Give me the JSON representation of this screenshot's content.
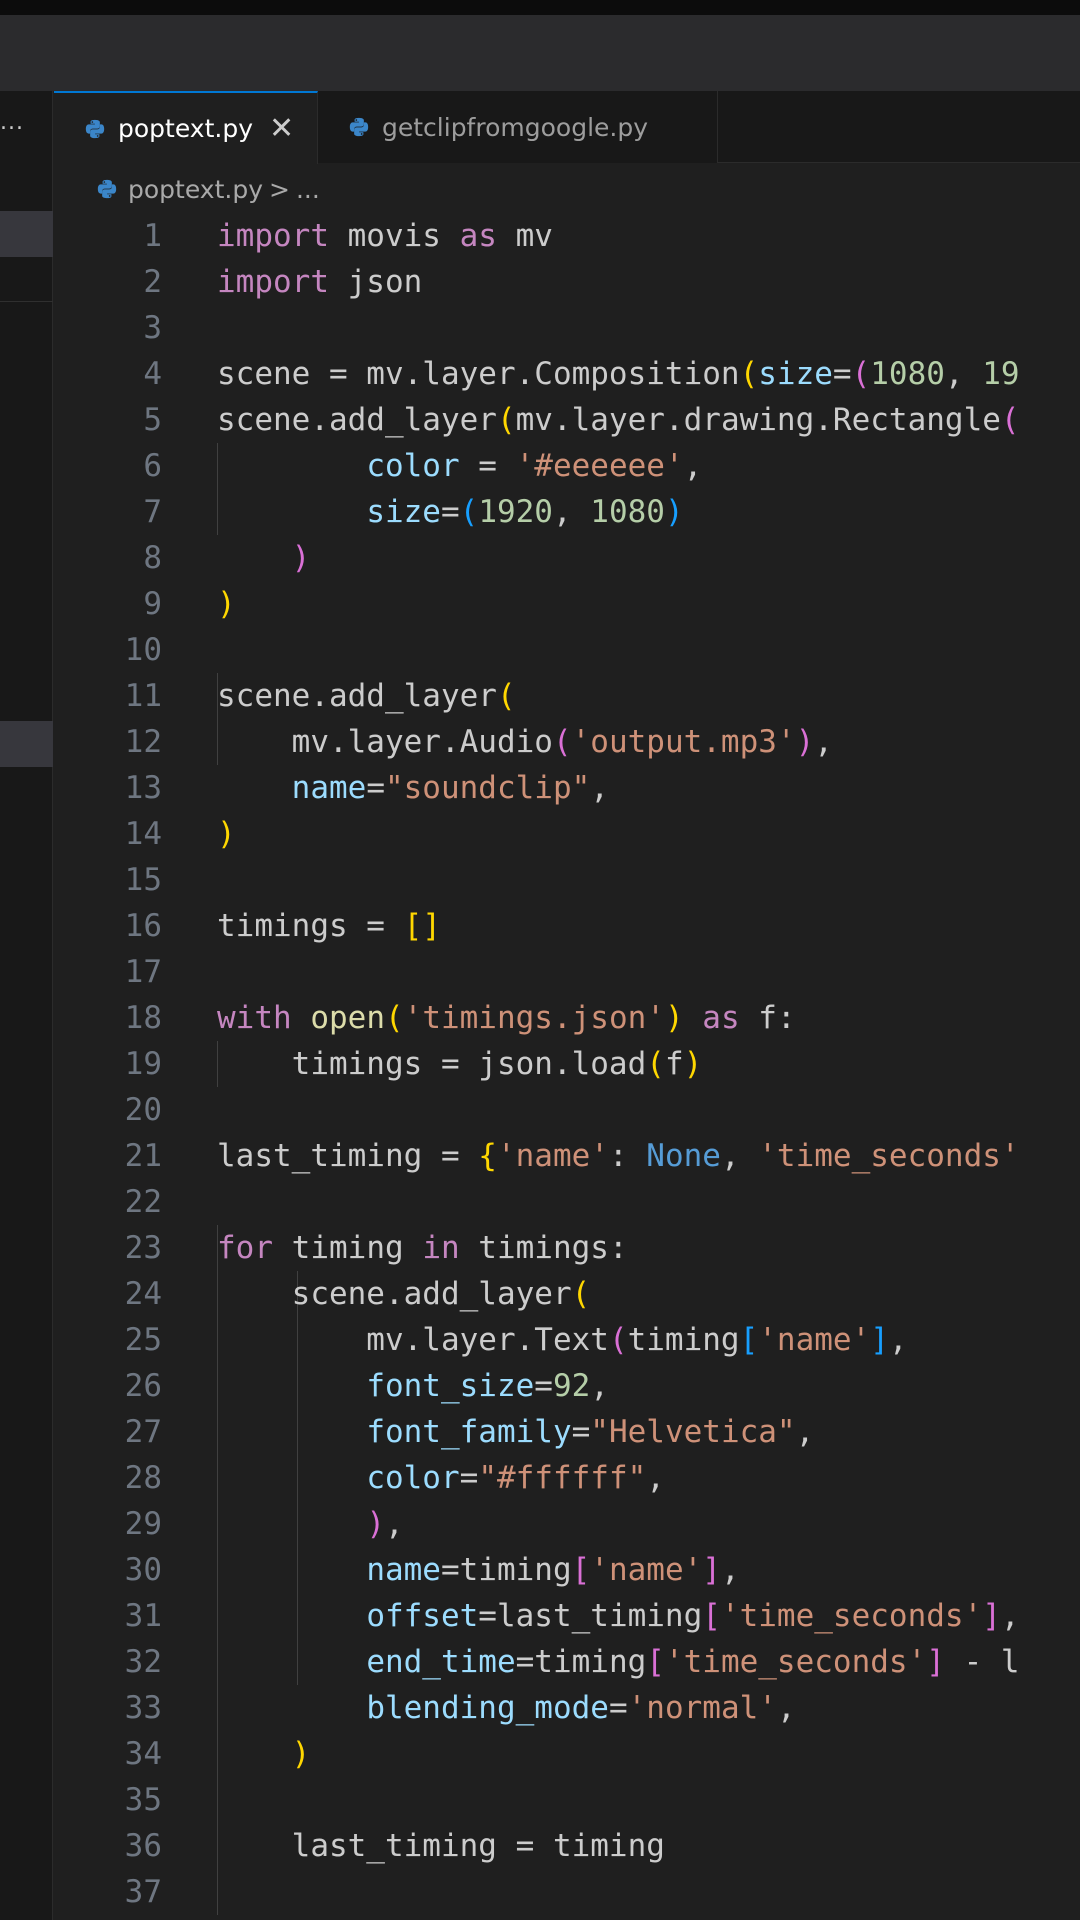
{
  "tabs": [
    {
      "label": "poptext.py",
      "active": true,
      "icon": "python-icon"
    },
    {
      "label": "getclipfromgoogle.py",
      "active": false,
      "icon": "python-icon"
    }
  ],
  "tab_close_glyph": "✕",
  "breadcrumb": {
    "file": "poptext.py",
    "separator": ">",
    "rest": "..."
  },
  "sidebar": {
    "more_glyph": "..."
  },
  "colors": {
    "accent": "#0078d4",
    "editor_bg": "#1f1f1f",
    "keyword": "#c586c0",
    "function": "#dcdcaa",
    "string": "#ce9178",
    "number": "#b5cea8",
    "parameter": "#9cdcfe",
    "constant": "#569cd6",
    "bracket_level1": "#ffd700",
    "bracket_level2": "#da70d6",
    "bracket_level3": "#179fff"
  },
  "code_lines": [
    {
      "n": "1",
      "tokens": [
        [
          "kw",
          "import"
        ],
        [
          "plain",
          " movis "
        ],
        [
          "kw",
          "as"
        ],
        [
          "plain",
          " mv"
        ]
      ]
    },
    {
      "n": "2",
      "tokens": [
        [
          "kw",
          "import"
        ],
        [
          "plain",
          " json"
        ]
      ]
    },
    {
      "n": "3",
      "tokens": []
    },
    {
      "n": "4",
      "tokens": [
        [
          "plain",
          "scene = mv.layer.Composition"
        ],
        [
          "b1",
          "("
        ],
        [
          "param",
          "size"
        ],
        [
          "plain",
          "="
        ],
        [
          "b2",
          "("
        ],
        [
          "num",
          "1080"
        ],
        [
          "plain",
          ", "
        ],
        [
          "num",
          "19"
        ]
      ]
    },
    {
      "n": "5",
      "tokens": [
        [
          "plain",
          "scene.add_layer"
        ],
        [
          "b1",
          "("
        ],
        [
          "plain",
          "mv.layer.drawing.Rectangle"
        ],
        [
          "b2",
          "("
        ]
      ]
    },
    {
      "n": "6",
      "tokens": [
        [
          "plain",
          "        "
        ],
        [
          "param",
          "color"
        ],
        [
          "plain",
          " = "
        ],
        [
          "str",
          "'#eeeeee'"
        ],
        [
          "plain",
          ","
        ]
      ]
    },
    {
      "n": "7",
      "tokens": [
        [
          "plain",
          "        "
        ],
        [
          "param",
          "size"
        ],
        [
          "plain",
          "="
        ],
        [
          "b3",
          "("
        ],
        [
          "num",
          "1920"
        ],
        [
          "plain",
          ", "
        ],
        [
          "num",
          "1080"
        ],
        [
          "b3",
          ")"
        ]
      ]
    },
    {
      "n": "8",
      "tokens": [
        [
          "plain",
          "    "
        ],
        [
          "b2",
          ")"
        ]
      ]
    },
    {
      "n": "9",
      "tokens": [
        [
          "b1",
          ")"
        ]
      ]
    },
    {
      "n": "10",
      "tokens": []
    },
    {
      "n": "11",
      "tokens": [
        [
          "plain",
          "scene.add_layer"
        ],
        [
          "b1",
          "("
        ]
      ]
    },
    {
      "n": "12",
      "tokens": [
        [
          "plain",
          "    mv.layer.Audio"
        ],
        [
          "b2",
          "("
        ],
        [
          "str",
          "'output.mp3'"
        ],
        [
          "b2",
          ")"
        ],
        [
          "plain",
          ","
        ]
      ]
    },
    {
      "n": "13",
      "tokens": [
        [
          "plain",
          "    "
        ],
        [
          "param",
          "name"
        ],
        [
          "plain",
          "="
        ],
        [
          "str",
          "\"soundclip\""
        ],
        [
          "plain",
          ","
        ]
      ]
    },
    {
      "n": "14",
      "tokens": [
        [
          "b1",
          ")"
        ]
      ]
    },
    {
      "n": "15",
      "tokens": []
    },
    {
      "n": "16",
      "tokens": [
        [
          "plain",
          "timings = "
        ],
        [
          "b1",
          "[]"
        ]
      ]
    },
    {
      "n": "17",
      "tokens": []
    },
    {
      "n": "18",
      "tokens": [
        [
          "kw",
          "with"
        ],
        [
          "plain",
          " "
        ],
        [
          "fn",
          "open"
        ],
        [
          "b1",
          "("
        ],
        [
          "str",
          "'timings.json'"
        ],
        [
          "b1",
          ")"
        ],
        [
          "plain",
          " "
        ],
        [
          "kw",
          "as"
        ],
        [
          "plain",
          " f:"
        ]
      ]
    },
    {
      "n": "19",
      "tokens": [
        [
          "plain",
          "    timings = json.load"
        ],
        [
          "b1",
          "("
        ],
        [
          "plain",
          "f"
        ],
        [
          "b1",
          ")"
        ]
      ]
    },
    {
      "n": "20",
      "tokens": []
    },
    {
      "n": "21",
      "tokens": [
        [
          "plain",
          "last_timing = "
        ],
        [
          "b1",
          "{"
        ],
        [
          "str",
          "'name'"
        ],
        [
          "plain",
          ": "
        ],
        [
          "const",
          "None"
        ],
        [
          "plain",
          ", "
        ],
        [
          "str",
          "'time_seconds'"
        ]
      ]
    },
    {
      "n": "22",
      "tokens": []
    },
    {
      "n": "23",
      "tokens": [
        [
          "kw",
          "for"
        ],
        [
          "plain",
          " timing "
        ],
        [
          "kw",
          "in"
        ],
        [
          "plain",
          " timings:"
        ]
      ]
    },
    {
      "n": "24",
      "tokens": [
        [
          "plain",
          "    scene.add_layer"
        ],
        [
          "b1",
          "("
        ]
      ]
    },
    {
      "n": "25",
      "tokens": [
        [
          "plain",
          "        mv.layer.Text"
        ],
        [
          "b2",
          "("
        ],
        [
          "plain",
          "timing"
        ],
        [
          "b3",
          "["
        ],
        [
          "str",
          "'name'"
        ],
        [
          "b3",
          "]"
        ],
        [
          "plain",
          ","
        ]
      ]
    },
    {
      "n": "26",
      "tokens": [
        [
          "plain",
          "        "
        ],
        [
          "param",
          "font_size"
        ],
        [
          "plain",
          "="
        ],
        [
          "num",
          "92"
        ],
        [
          "plain",
          ","
        ]
      ]
    },
    {
      "n": "27",
      "tokens": [
        [
          "plain",
          "        "
        ],
        [
          "param",
          "font_family"
        ],
        [
          "plain",
          "="
        ],
        [
          "str",
          "\"Helvetica\""
        ],
        [
          "plain",
          ","
        ]
      ]
    },
    {
      "n": "28",
      "tokens": [
        [
          "plain",
          "        "
        ],
        [
          "param",
          "color"
        ],
        [
          "plain",
          "="
        ],
        [
          "str",
          "\"#ffffff\""
        ],
        [
          "plain",
          ","
        ]
      ]
    },
    {
      "n": "29",
      "tokens": [
        [
          "plain",
          "        "
        ],
        [
          "b2",
          ")"
        ],
        [
          "plain",
          ","
        ]
      ]
    },
    {
      "n": "30",
      "tokens": [
        [
          "plain",
          "        "
        ],
        [
          "param",
          "name"
        ],
        [
          "plain",
          "=timing"
        ],
        [
          "b2",
          "["
        ],
        [
          "str",
          "'name'"
        ],
        [
          "b2",
          "]"
        ],
        [
          "plain",
          ","
        ]
      ]
    },
    {
      "n": "31",
      "tokens": [
        [
          "plain",
          "        "
        ],
        [
          "param",
          "offset"
        ],
        [
          "plain",
          "=last_timing"
        ],
        [
          "b2",
          "["
        ],
        [
          "str",
          "'time_seconds'"
        ],
        [
          "b2",
          "]"
        ],
        [
          "plain",
          ","
        ]
      ]
    },
    {
      "n": "32",
      "tokens": [
        [
          "plain",
          "        "
        ],
        [
          "param",
          "end_time"
        ],
        [
          "plain",
          "=timing"
        ],
        [
          "b2",
          "["
        ],
        [
          "str",
          "'time_seconds'"
        ],
        [
          "b2",
          "]"
        ],
        [
          "plain",
          " - l"
        ]
      ]
    },
    {
      "n": "33",
      "tokens": [
        [
          "plain",
          "        "
        ],
        [
          "param",
          "blending_mode"
        ],
        [
          "plain",
          "="
        ],
        [
          "str",
          "'normal'"
        ],
        [
          "plain",
          ","
        ]
      ]
    },
    {
      "n": "34",
      "tokens": [
        [
          "plain",
          "    "
        ],
        [
          "b1",
          ")"
        ]
      ]
    },
    {
      "n": "35",
      "tokens": []
    },
    {
      "n": "36",
      "tokens": [
        [
          "plain",
          "    last_timing = timing"
        ]
      ]
    },
    {
      "n": "37",
      "tokens": []
    }
  ]
}
